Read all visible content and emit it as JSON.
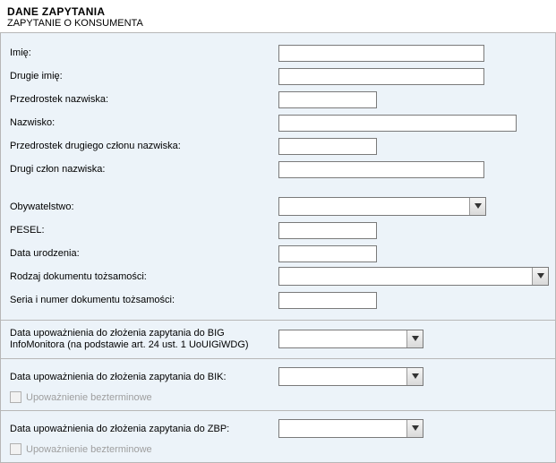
{
  "header": {
    "title": "DANE ZAPYTANIA",
    "subtitle": "ZAPYTANIE O KONSUMENTA"
  },
  "fields": {
    "imie": "Imię:",
    "drugie_imie": "Drugie imię:",
    "przedrostek_nazwiska": "Przedrostek nazwiska:",
    "nazwisko": "Nazwisko:",
    "przedrostek_drugiego": "Przedrostek drugiego członu nazwiska:",
    "drugi_czlon": "Drugi człon nazwiska:",
    "obywatelstwo": "Obywatelstwo:",
    "pesel": "PESEL:",
    "data_ur": "Data urodzenia:",
    "rodzaj_dok": "Rodzaj dokumentu tożsamości:",
    "seria_nr": "Seria i numer dokumentu tożsamości:"
  },
  "auth": {
    "big_label": "Data upoważnienia do złożenia zapytania do BIG InfoMonitora (na podstawie art. 24 ust. 1 UoUIGiWDG)",
    "bik_label": "Data upoważnienia do złożenia zapytania do BIK:",
    "zbp_label": "Data upoważnienia do złożenia zapytania do ZBP:",
    "unlimited_label": "Upoważnienie bezterminowe"
  },
  "values": {
    "imie": "",
    "drugie_imie": "",
    "przedrostek_nazwiska": "",
    "nazwisko": "",
    "przedrostek_drugiego": "",
    "drugi_czlon": "",
    "obywatelstwo": "",
    "pesel": "",
    "data_ur": "",
    "rodzaj_dok": "",
    "seria_nr": "",
    "big_date": "",
    "bik_date": "",
    "zbp_date": ""
  }
}
